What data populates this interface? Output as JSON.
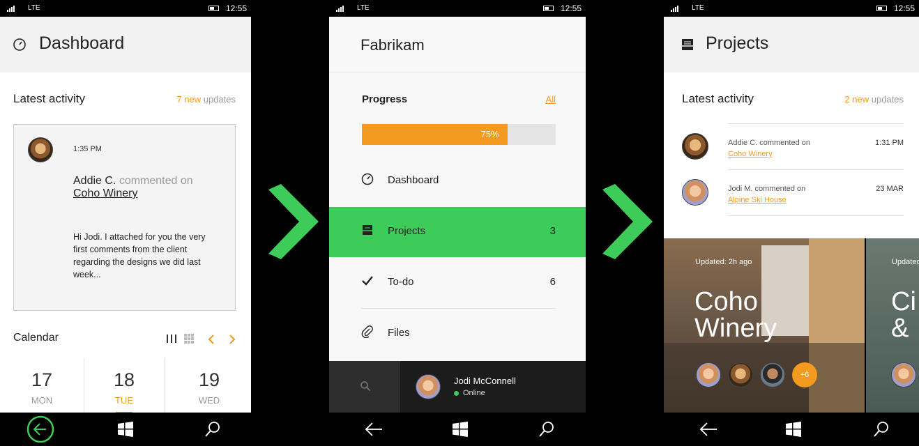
{
  "status": {
    "network": "LTE",
    "time": "12:55"
  },
  "dashboard": {
    "title": "Dashboard",
    "latest_activity": "Latest activity",
    "new_count": "7 new",
    "new_suffix": " updates",
    "card": {
      "time": "1:35 PM",
      "author": "Addie C.",
      "action": " commented on",
      "project": "Coho Winery",
      "message": "Hi Jodi. I attached for you the very first comments from the client regarding the designs we did last week..."
    },
    "calendar": {
      "label": "Calendar",
      "days": [
        {
          "num": "17",
          "name": "MON"
        },
        {
          "num": "18",
          "name": "TUE"
        },
        {
          "num": "19",
          "name": "WED"
        }
      ]
    }
  },
  "fabrikam": {
    "title": "Fabrikam",
    "progress_label": "Progress",
    "all_link": "All",
    "progress_pct": 0.75,
    "progress_text": "75%",
    "menu": [
      {
        "label": "Dashboard",
        "count": "",
        "icon": "clock-icon"
      },
      {
        "label": "Projects",
        "count": "3",
        "icon": "inbox-icon"
      },
      {
        "label": "To-do",
        "count": "6",
        "icon": "checkmark-icon"
      },
      {
        "label": "Files",
        "count": "",
        "icon": "paperclip-icon"
      }
    ],
    "user": {
      "name": "Jodi McConnell",
      "status": "Online"
    }
  },
  "projects": {
    "title": "Projects",
    "latest_activity": "Latest activity",
    "new_count": "2 new",
    "new_suffix": " updates",
    "activity": [
      {
        "who": "Addie C. commented on",
        "project": "Coho Winery",
        "time": "1:31 PM"
      },
      {
        "who": "Jodi M. commented on",
        "project": "Alpine Ski House",
        "time": "23 MAR"
      }
    ],
    "tiles": [
      {
        "updated": "Updated: 2h ago",
        "name_line1": "Coho",
        "name_line2": "Winery",
        "more": "+6"
      },
      {
        "updated": "Updated",
        "name_line1": "Ci",
        "name_line2": "& "
      }
    ]
  },
  "colors": {
    "accent": "#f39b1f",
    "green": "#3dcc59"
  }
}
